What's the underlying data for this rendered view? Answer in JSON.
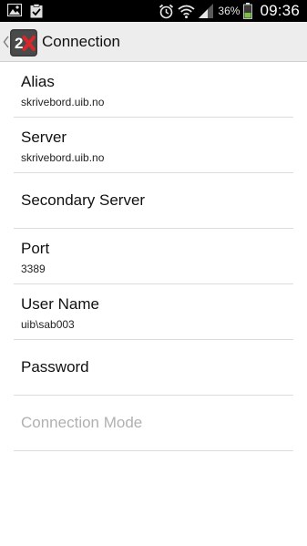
{
  "status_bar": {
    "icons": [
      "gallery-icon",
      "clipboard-check-icon",
      "alarm-clock-icon",
      "wifi-icon",
      "signal-icon",
      "battery-icon"
    ],
    "battery_percent": "36%",
    "time": "09:36"
  },
  "action_bar": {
    "logo_icon": "app-logo-2x-icon",
    "title": "Connection"
  },
  "settings": [
    {
      "title": "Alias",
      "summary": "skrivebord.uib.no",
      "enabled": true
    },
    {
      "title": "Server",
      "summary": "skrivebord.uib.no",
      "enabled": true
    },
    {
      "title": "Secondary Server",
      "summary": "",
      "enabled": true
    },
    {
      "title": "Port",
      "summary": "3389",
      "enabled": true
    },
    {
      "title": "User Name",
      "summary": "uib\\sab003",
      "enabled": true
    },
    {
      "title": "Password",
      "summary": "",
      "enabled": true
    },
    {
      "title": "Connection Mode",
      "summary": "",
      "enabled": false
    }
  ],
  "colors": {
    "status_bar_bg": "#000000",
    "action_bar_bg": "#ededed",
    "logo_red": "#d9262b",
    "battery_green": "#7cc242",
    "disabled_text": "#b0b0b0"
  }
}
